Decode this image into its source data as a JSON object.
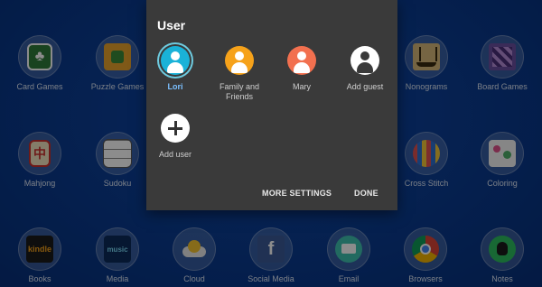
{
  "dialog": {
    "title": "User",
    "users": [
      {
        "name": "Lori",
        "color": "#1ab2d8",
        "active": true
      },
      {
        "name": "Family and Friends",
        "color": "#f6a21a",
        "active": false
      },
      {
        "name": "Mary",
        "color": "#f2704f",
        "active": false
      },
      {
        "name": "Add guest",
        "color": "#ffffff",
        "active": false
      }
    ],
    "add_user_label": "Add user",
    "more_settings_label": "MORE SETTINGS",
    "done_label": "DONE"
  },
  "apps": {
    "row1": [
      "Card Games",
      "Puzzle Games",
      "Nonograms",
      "Board Games"
    ],
    "row2": [
      "Mahjong",
      "Sudoku",
      "Cross Stitch",
      "Coloring"
    ],
    "row3": [
      "Books",
      "Media",
      "Cloud",
      "Social Media",
      "Email",
      "Browsers",
      "Notes"
    ]
  },
  "icons": {
    "card-games": "spade-cards-icon",
    "puzzle-games": "puzzle-icon",
    "nonograms": "ship-icon",
    "board-games": "board-icon",
    "mahjong": "tile-icon",
    "sudoku": "grid-icon",
    "cross-stitch": "stitch-icon",
    "coloring": "paint-icon",
    "books": "kindle-icon",
    "media": "amazon-music-icon",
    "cloud": "cloud-icon",
    "social-media": "facebook-icon",
    "email": "email-icon",
    "browsers": "chrome-icon",
    "notes": "evernote-icon"
  }
}
